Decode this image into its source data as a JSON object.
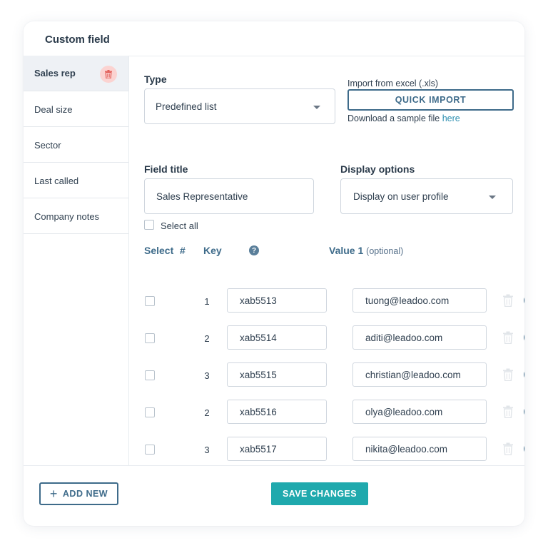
{
  "card": {
    "title": "Custom field"
  },
  "sidebar": {
    "items": [
      {
        "label": "Sales rep",
        "active": true
      },
      {
        "label": "Deal size"
      },
      {
        "label": "Sector"
      },
      {
        "label": "Last called"
      },
      {
        "label": "Company notes"
      }
    ]
  },
  "type": {
    "label": "Type",
    "selected": "Predefined list"
  },
  "import": {
    "label": "Import from excel (.xls)",
    "button": "QUICK IMPORT",
    "download_text": "Download a sample file",
    "download_link": "here"
  },
  "field_title": {
    "label": "Field title",
    "value": "Sales Representative"
  },
  "display_options": {
    "label": "Display options",
    "selected": "Display on user profile"
  },
  "select_all": "Select all",
  "columns": {
    "select": "Select",
    "num": "#",
    "key": "Key",
    "help": "?",
    "value": "Value 1",
    "value_note": "(optional)"
  },
  "rows": [
    {
      "num": "1",
      "key": "xab5513",
      "value": "tuong@leadoo.com"
    },
    {
      "num": "2",
      "key": "xab5514",
      "value": "aditi@leadoo.com"
    },
    {
      "num": "3",
      "key": "xab5515",
      "value": "christian@leadoo.com"
    },
    {
      "num": "2",
      "key": "xab5516",
      "value": "olya@leadoo.com"
    },
    {
      "num": "3",
      "key": "xab5517",
      "value": "nikita@leadoo.com"
    }
  ],
  "footer": {
    "add_new": "ADD NEW",
    "add_new_icon": "+",
    "save": "SAVE CHANGES"
  },
  "row_add_icon": "+",
  "colors": {
    "accent": "#1fa9ad",
    "primary": "#3e6b8a",
    "danger_bg": "#fbd3d1",
    "link": "#2d8fb0"
  }
}
